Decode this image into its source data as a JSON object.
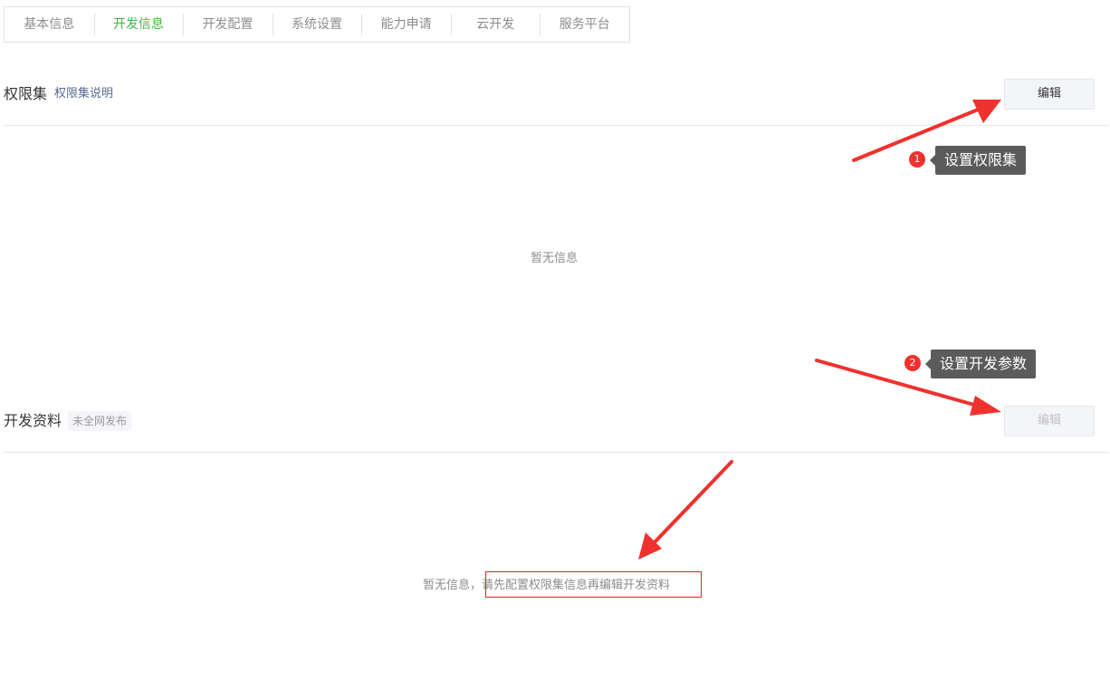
{
  "tabs": [
    {
      "label": "基本信息",
      "active": false
    },
    {
      "label": "开发信息",
      "active": true
    },
    {
      "label": "开发配置",
      "active": false
    },
    {
      "label": "系统设置",
      "active": false
    },
    {
      "label": "能力申请",
      "active": false
    },
    {
      "label": "云开发",
      "active": false
    },
    {
      "label": "服务平台",
      "active": false
    }
  ],
  "permission": {
    "title": "权限集",
    "link": "权限集说明",
    "edit_label": "编辑",
    "empty_text": "暂无信息"
  },
  "dev": {
    "title": "开发资料",
    "status": "未全网发布",
    "edit_label": "编辑",
    "empty_prefix": "暂无信息，",
    "empty_hint": "请先配置权限集信息再编辑开发资料"
  },
  "annotations": {
    "step1": {
      "number": "1",
      "text": "设置权限集"
    },
    "step2": {
      "number": "2",
      "text": "设置开发参数"
    }
  },
  "colors": {
    "accent": "#44b549",
    "link": "#576b95",
    "annotation_red": "#f0312d"
  }
}
